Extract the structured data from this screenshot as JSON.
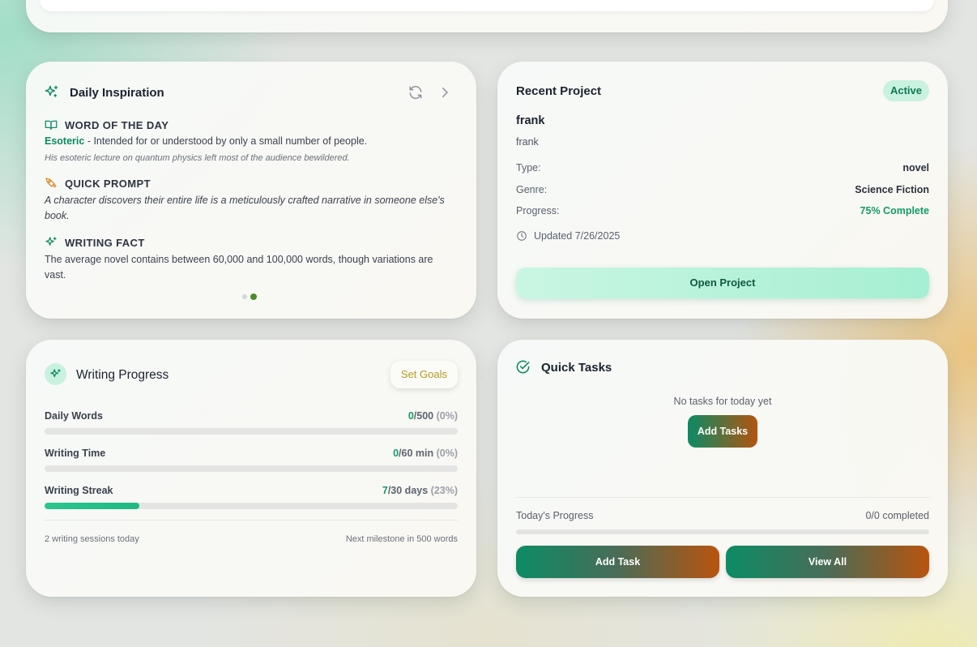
{
  "inspiration": {
    "title": "Daily Inspiration",
    "word_heading": "WORD OF THE DAY",
    "word": "Esoteric",
    "word_definition": " - Intended for or understood by only a small number of people.",
    "word_example": "His esoteric lecture on quantum physics left most of the audience bewildered.",
    "prompt_heading": "QUICK PROMPT",
    "prompt_line1": "A character discovers their entire life is a meticulously crafted narrative in someone else's",
    "prompt_line2": "book.",
    "fact_heading": "WRITING FACT",
    "fact_line1": "The average novel contains between 60,000 and 100,000 words, though variations are",
    "fact_line2": "vast.",
    "active_slide": 2,
    "slides": 2
  },
  "project": {
    "title": "Recent Project",
    "status": "Active",
    "name": "frank",
    "description": "frank",
    "type_label": "Type:",
    "type_value": "novel",
    "genre_label": "Genre:",
    "genre_value": "Science Fiction",
    "progress_label": "Progress:",
    "progress_value": "75% Complete",
    "updated": "Updated 7/26/2025",
    "open_label": "Open Project"
  },
  "writing_progress": {
    "title": "Writing Progress",
    "set_goals_label": "Set Goals",
    "rows": [
      {
        "label": "Daily Words",
        "current": "0",
        "total": "/500",
        "pct": "(0%)",
        "fraction": 0
      },
      {
        "label": "Writing Time",
        "current": "0",
        "total": "/60 min",
        "pct": "(0%)",
        "fraction": 0
      },
      {
        "label": "Writing Streak",
        "current": "7",
        "total": "/30 days",
        "pct": "(23%)",
        "fraction": 0.23
      }
    ],
    "sessions_text": "2 writing sessions today",
    "milestone_text": "Next milestone in 500 words"
  },
  "tasks": {
    "title": "Quick Tasks",
    "empty_text": "No tasks for today yet",
    "add_tasks_label": "Add Tasks",
    "today_label": "Today's Progress",
    "today_value": "0/0 completed",
    "today_fraction": 0,
    "add_task_label": "Add Task",
    "view_all_label": "View All"
  },
  "colors": {
    "accent_green": "#0e8a63",
    "accent_orange": "#b9540e",
    "active_badge_bg": "#c9f2df"
  }
}
